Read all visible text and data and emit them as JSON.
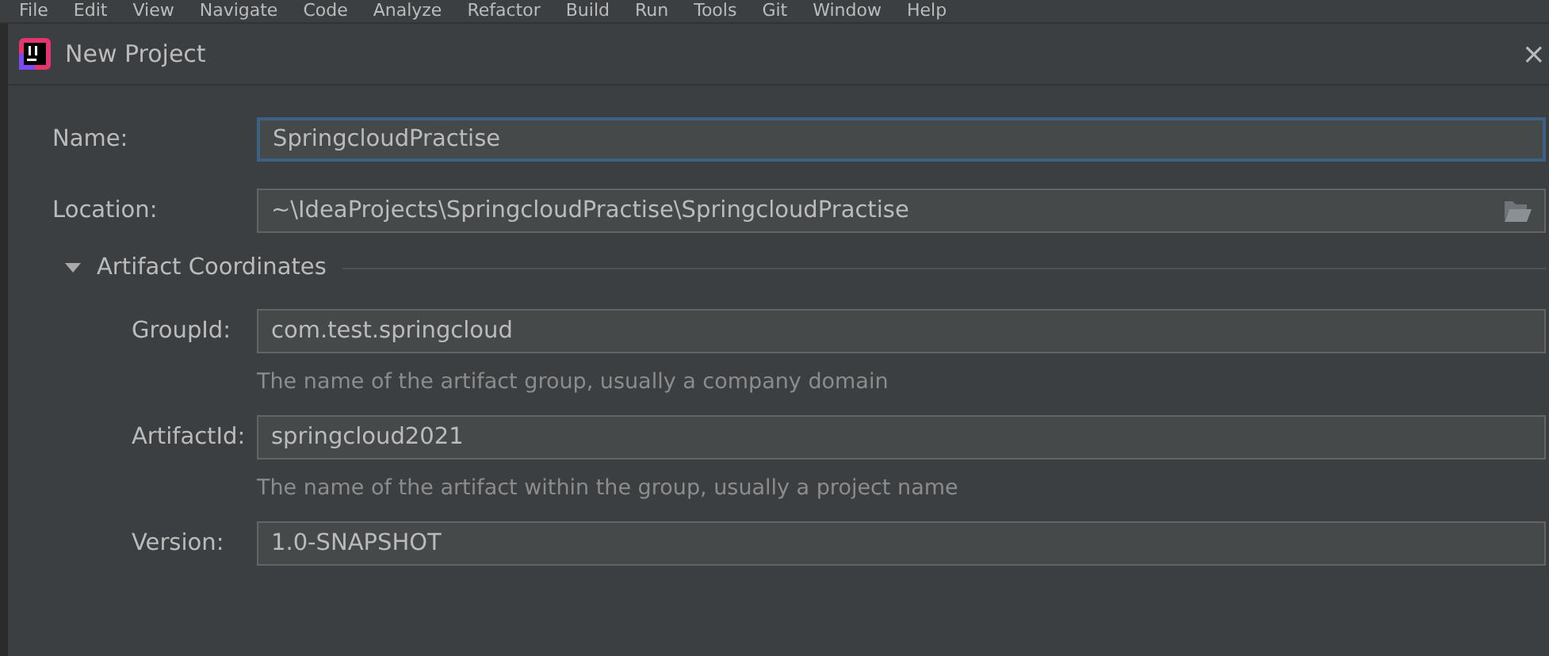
{
  "menu_bar": [
    "File",
    "Edit",
    "View",
    "Navigate",
    "Code",
    "Analyze",
    "Refactor",
    "Build",
    "Run",
    "Tools",
    "Git",
    "Window",
    "Help"
  ],
  "window": {
    "title": "New Project",
    "close": "×"
  },
  "fields": [
    {
      "label": "Name:",
      "value": "SpringcloudPractise",
      "focused": true,
      "browse": false
    },
    {
      "label": "Location:",
      "value": "~\\IdeaProjects\\SpringcloudPractise\\SpringcloudPractise",
      "focused": false,
      "browse": true
    }
  ],
  "section": {
    "title": "Artifact Coordinates",
    "expanded": true,
    "fields": [
      {
        "label": "GroupId:",
        "value": "com.test.springcloud",
        "hint": "The name of the artifact group, usually a company domain"
      },
      {
        "label": "ArtifactId:",
        "value": "springcloud2021",
        "hint": "The name of the artifact within the group, usually a project name"
      },
      {
        "label": "Version:",
        "value": "1.0-SNAPSHOT"
      }
    ]
  }
}
